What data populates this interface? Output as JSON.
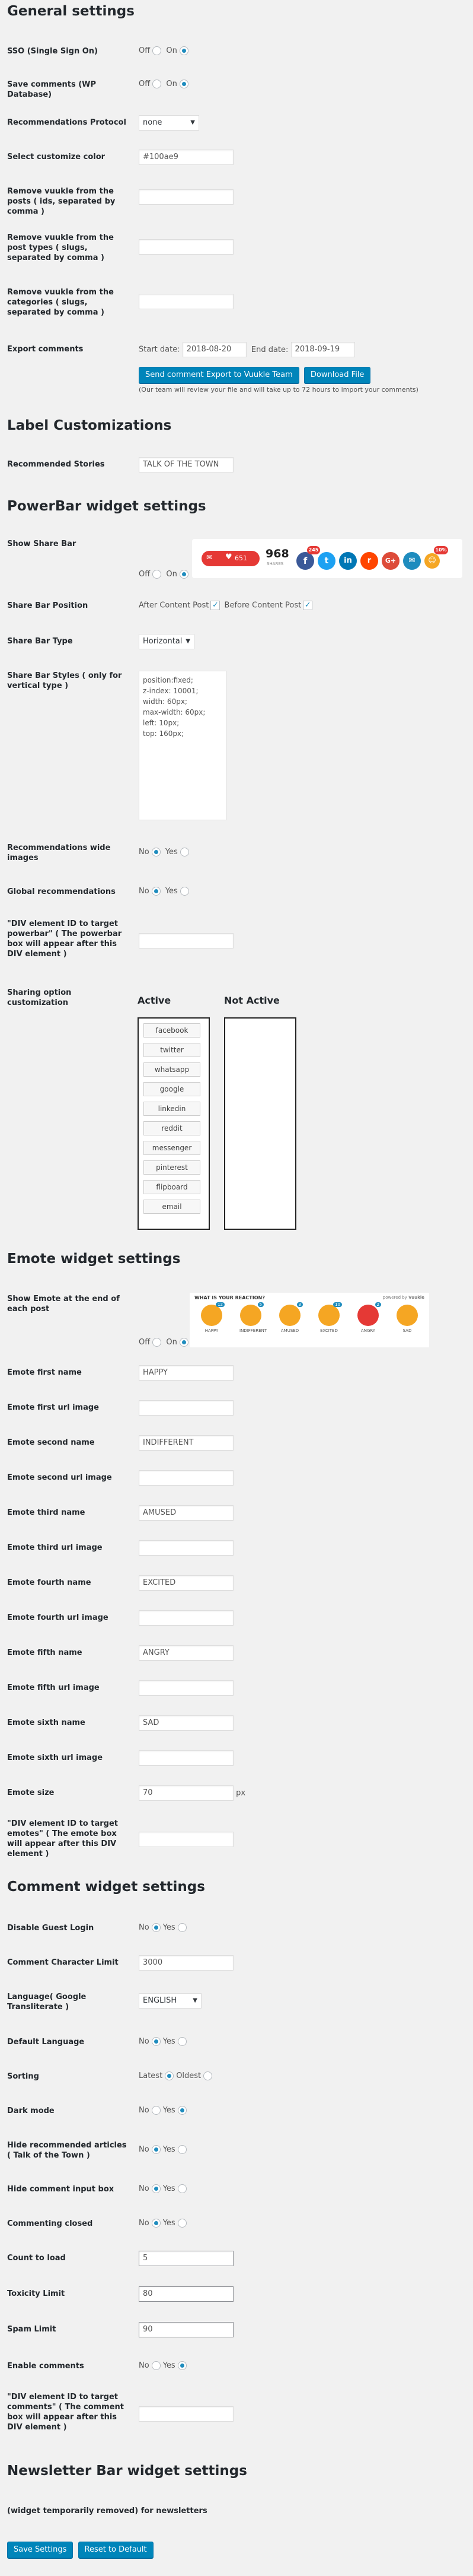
{
  "general": {
    "title": "General settings",
    "sso_label": "SSO (Single Sign On)",
    "save_comments_label": "Save comments (WP Database)",
    "off": "Off",
    "on": "On",
    "reco_protocol_label": "Recommendations Protocol",
    "reco_protocol_value": "none",
    "customize_color_label": "Select customize color",
    "customize_color_value": "#100ae9",
    "remove_posts_label": "Remove vuukle from the posts ( ids, separated by comma )",
    "remove_post_types_label": "Remove vuukle from the post types ( slugs, separated by comma )",
    "remove_categories_label": "Remove vuukle from the categories ( slugs, separated by comma )",
    "export_label": "Export comments",
    "start_date_label": "Start date:",
    "start_date_value": "2018-08-20",
    "end_date_label": "End date:",
    "end_date_value": "2018-09-19",
    "send_export_button": "Send comment Export to Vuukle Team",
    "download_button": "Download File",
    "export_note": "(Our team will review your file and will take up to 72 hours to import your comments)"
  },
  "label_custom": {
    "title": "Label Customizations",
    "recommended_label": "Recommended Stories",
    "recommended_value": "TALK OF THE TOWN"
  },
  "powerbar": {
    "title": "PowerBar widget settings",
    "show_label": "Show Share Bar",
    "off": "Off",
    "on": "On",
    "preview": {
      "count_a": "651",
      "total": "968",
      "total_label": "SHARES",
      "badge_fb": "245",
      "badge_emote": "10%"
    },
    "position_label": "Share Bar Position",
    "after_content": "After Content Post",
    "before_content": "Before Content Post",
    "type_label": "Share Bar Type",
    "type_value": "Horizontal",
    "styles_label": "Share Bar Styles ( only for vertical type )",
    "styles_value": [
      "position:fixed;",
      "z-index: 10001;",
      "width: 60px;",
      "max-width: 60px;",
      "left: 10px;",
      "top: 160px;"
    ],
    "reco_wide_label": "Recommendations wide images",
    "global_reco_label": "Global recommendations",
    "no": "No",
    "yes": "Yes",
    "div_target_label": "\"DIV element ID to target powerbar\" ( The powerbar box will appear after this DIV element )",
    "sharing_label": "Sharing option customization",
    "active_title": "Active",
    "not_active_title": "Not Active",
    "active_items": [
      "facebook",
      "twitter",
      "whatsapp",
      "google",
      "linkedin",
      "reddit",
      "messenger",
      "pinterest",
      "flipboard",
      "email"
    ]
  },
  "emote": {
    "title": "Emote widget settings",
    "show_label": "Show Emote at the end of each post",
    "off": "Off",
    "on": "On",
    "preview": {
      "question": "WHAT IS YOUR REACTION?",
      "powered": "powered by",
      "brand": "Vuukle",
      "faces": [
        {
          "name": "HAPPY",
          "count": "12",
          "color": "#f5a623"
        },
        {
          "name": "INDIFFERENT",
          "count": "5",
          "color": "#f5a623"
        },
        {
          "name": "AMUSED",
          "count": "3",
          "color": "#f5a623"
        },
        {
          "name": "EXCITED",
          "count": "10",
          "color": "#f5a623"
        },
        {
          "name": "ANGRY",
          "count": "2",
          "color": "#e53935"
        },
        {
          "name": "SAD",
          "count": "",
          "color": "#f5a623"
        }
      ]
    },
    "fields": [
      {
        "label": "Emote first name",
        "value": "HAPPY"
      },
      {
        "label": "Emote first url image",
        "value": ""
      },
      {
        "label": "Emote second name",
        "value": "INDIFFERENT"
      },
      {
        "label": "Emote second url image",
        "value": ""
      },
      {
        "label": "Emote third name",
        "value": "AMUSED"
      },
      {
        "label": "Emote third url image",
        "value": ""
      },
      {
        "label": "Emote fourth name",
        "value": "EXCITED"
      },
      {
        "label": "Emote fourth url image",
        "value": ""
      },
      {
        "label": "Emote fifth name",
        "value": "ANGRY"
      },
      {
        "label": "Emote fifth url image",
        "value": ""
      },
      {
        "label": "Emote sixth name",
        "value": "SAD"
      },
      {
        "label": "Emote sixth url image",
        "value": ""
      },
      {
        "label": "Emote size",
        "value": "70"
      }
    ],
    "size_unit": "px",
    "div_target_label": "\"DIV element ID to target emotes\" ( The emote box will appear after this DIV element )"
  },
  "comment": {
    "title": "Comment widget settings",
    "disable_guest_label": "Disable Guest Login",
    "char_limit_label": "Comment Character Limit",
    "char_limit_value": "3000",
    "language_translit_label": "Language( Google Transliterate )",
    "language_translit_value": "ENGLISH",
    "default_language_label": "Default Language",
    "sorting_label": "Sorting",
    "latest": "Latest",
    "oldest": "Oldest",
    "dark_mode_label": "Dark mode",
    "hide_reco_label": "Hide recommended articles ( Talk of the Town )",
    "hide_input_label": "Hide comment input box",
    "commenting_closed_label": "Commenting closed",
    "count_load_label": "Count to load",
    "count_load_value": "5",
    "toxicity_label": "Toxicity Limit",
    "toxicity_value": "80",
    "spam_label": "Spam Limit",
    "spam_value": "90",
    "enable_comments_label": "Enable comments",
    "div_target_label": "\"DIV element ID to target comments\" ( The comment box will appear after this DIV element )",
    "no": "No",
    "yes": "Yes"
  },
  "newsletter": {
    "title": "Newsletter Bar widget settings",
    "note": "(widget temporarily removed) for newsletters"
  },
  "footer": {
    "save_button": "Save Settings",
    "reset_button": "Reset to Default"
  },
  "colors": {
    "accent": "#0085ba",
    "radio": "#1e8cbe"
  }
}
